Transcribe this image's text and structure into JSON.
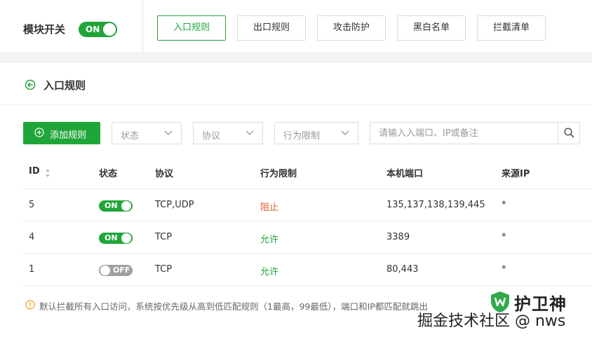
{
  "header": {
    "module_label": "模块开关",
    "module_toggle": "ON",
    "tabs": [
      {
        "label": "入口规则",
        "active": true
      },
      {
        "label": "出口规则",
        "active": false
      },
      {
        "label": "攻击防护",
        "active": false
      },
      {
        "label": "黑白名单",
        "active": false
      },
      {
        "label": "拦截清单",
        "active": false
      }
    ]
  },
  "panel": {
    "title": "入口规则",
    "add_label": "添加规则",
    "filters": {
      "status": "状态",
      "protocol": "协议",
      "behavior": "行为限制"
    },
    "search_placeholder": "请输入入端口、IP或备注"
  },
  "table": {
    "columns": [
      "ID",
      "状态",
      "协议",
      "行为限制",
      "本机端口",
      "来源IP"
    ],
    "rows": [
      {
        "id": "5",
        "status": "ON",
        "protocol": "TCP,UDP",
        "behavior": "阻止",
        "port": "135,137,138,139,445",
        "source": "*"
      },
      {
        "id": "4",
        "status": "ON",
        "protocol": "TCP",
        "behavior": "允许",
        "port": "3389",
        "source": "*"
      },
      {
        "id": "1",
        "status": "OFF",
        "protocol": "TCP",
        "behavior": "允许",
        "port": "80,443",
        "source": "*"
      }
    ]
  },
  "note": "默认拦截所有入口访问，系统按优先级从高到低匹配规则（1最高，99最低），端口和IP都匹配就跳出",
  "watermark": {
    "brand": "护卫神",
    "line": "掘金技术社区 @ nws"
  },
  "colors": {
    "accent": "#20a53a",
    "deny": "#e35a2b",
    "off": "#a0a0a0"
  }
}
